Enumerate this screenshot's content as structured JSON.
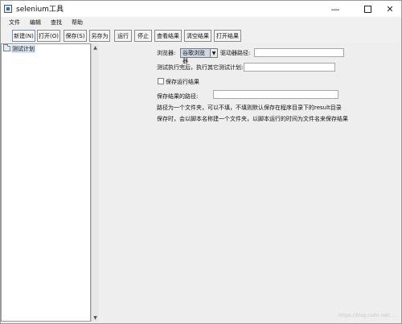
{
  "window": {
    "title": "selenium工具"
  },
  "menu": [
    "文件",
    "编辑",
    "查找",
    "帮助"
  ],
  "toolbar": [
    "新建(N)",
    "打开(O)",
    "保存(S)",
    "另存为",
    "运行",
    "停止",
    "查看结果",
    "清空结果",
    "打开结果"
  ],
  "tree": {
    "root": "测试计划"
  },
  "form": {
    "browser_label": "浏览器:",
    "browser_value": "谷歌浏览器",
    "driver_label": "驱动器路径:",
    "driver_value": "",
    "after_label": "测试执行完后，执行其它测试计划:",
    "after_value": "",
    "save_checkbox_label": "保存运行结果",
    "save_path_label": "保存结果的路径:",
    "save_path_value": "",
    "note1": "路径为一个文件夹，可以不填，不填则默认保存在程序目录下的result目录",
    "note2": "保存时，会以脚本名称建一个文件夹，以脚本运行的时间为文件名来保存结果"
  },
  "watermark": "https://blog.csdn.net/..."
}
